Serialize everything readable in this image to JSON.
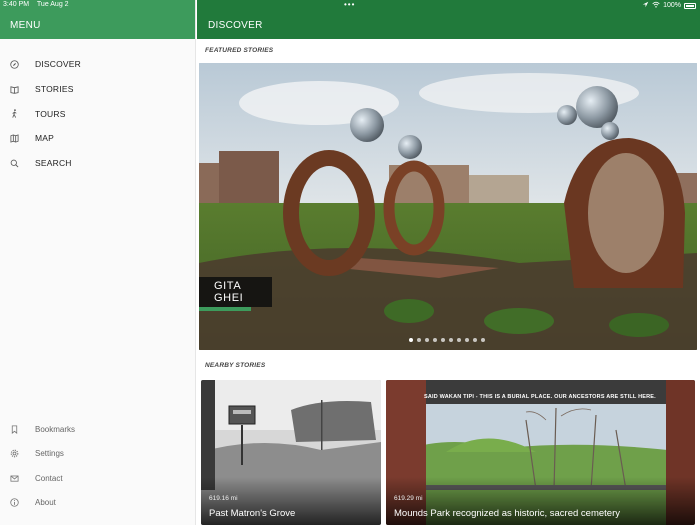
{
  "status_bar": {
    "time": "3:40 PM",
    "date": "Tue Aug 2",
    "battery": "100%"
  },
  "sidebar": {
    "title": "MENU",
    "nav": [
      {
        "label": "DISCOVER",
        "icon": "compass-icon"
      },
      {
        "label": "STORIES",
        "icon": "book-icon"
      },
      {
        "label": "TOURS",
        "icon": "walking-person-icon"
      },
      {
        "label": "MAP",
        "icon": "map-icon"
      },
      {
        "label": "SEARCH",
        "icon": "search-icon"
      }
    ],
    "secondary": [
      {
        "label": "Bookmarks",
        "icon": "bookmark-icon"
      },
      {
        "label": "Settings",
        "icon": "gear-icon"
      },
      {
        "label": "Contact",
        "icon": "mail-icon"
      },
      {
        "label": "About",
        "icon": "info-icon"
      }
    ]
  },
  "main": {
    "title": "DISCOVER",
    "featured_label": "FEATURED STORIES",
    "featured": {
      "caption": "GITA GHEI",
      "slide_count": 10,
      "active_slide": 0
    },
    "nearby_label": "NEARBY STORIES",
    "nearby": [
      {
        "distance": "619.16 mi",
        "title": "Past Matron's Grove"
      },
      {
        "distance": "619.29 mi",
        "title": "Mounds Park recognized as historic, sacred cemetery",
        "sign": "SAID WAKAN TIPI - THIS IS A BURIAL PLACE. OUR ANCESTORS ARE STILL HERE."
      }
    ]
  },
  "colors": {
    "sidebar_header": "#3d9b5c",
    "main_header": "#217a3b",
    "accent": "#3d9b5c"
  }
}
